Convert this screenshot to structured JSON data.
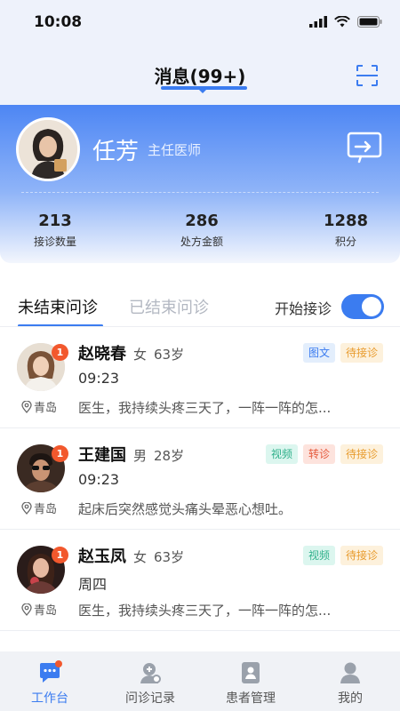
{
  "status_bar": {
    "time": "10:08"
  },
  "header": {
    "title": "消息(99+)"
  },
  "doctor": {
    "name": "任芳",
    "title": "主任医师"
  },
  "stats": [
    {
      "value": "213",
      "label": "接诊数量"
    },
    {
      "value": "286",
      "label": "处方金额"
    },
    {
      "value": "1288",
      "label": "积分"
    }
  ],
  "tabs": {
    "active": "未结束问诊",
    "inactive": "已结束问诊"
  },
  "toggle": {
    "label": "开始接诊",
    "on": true
  },
  "consultations": [
    {
      "badge": "1",
      "name": "赵晓春",
      "gender": "女",
      "age": "63岁",
      "time": "09:23",
      "location": "青岛",
      "message": "医生，我持续头疼三天了，一阵一阵的怎...",
      "tags": [
        "图文",
        "待接诊"
      ]
    },
    {
      "badge": "1",
      "name": "王建国",
      "gender": "男",
      "age": "28岁",
      "time": "09:23",
      "location": "青岛",
      "message": "起床后突然感觉头痛头晕恶心想吐。",
      "tags": [
        "视频",
        "转诊",
        "待接诊"
      ]
    },
    {
      "badge": "1",
      "name": "赵玉凤",
      "gender": "女",
      "age": "63岁",
      "time": "周四",
      "location": "青岛",
      "message": "医生，我持续头疼三天了，一阵一阵的怎...",
      "tags": [
        "视频",
        "待接诊"
      ]
    }
  ],
  "tab_bar": [
    {
      "label": "工作台",
      "icon": "chat-icon",
      "active": true
    },
    {
      "label": "问诊记录",
      "icon": "consult-record-icon",
      "active": false
    },
    {
      "label": "患者管理",
      "icon": "patient-card-icon",
      "active": false
    },
    {
      "label": "我的",
      "icon": "person-icon",
      "active": false
    }
  ],
  "colors": {
    "accent": "#3b7cf0",
    "badge": "#f2582d"
  }
}
